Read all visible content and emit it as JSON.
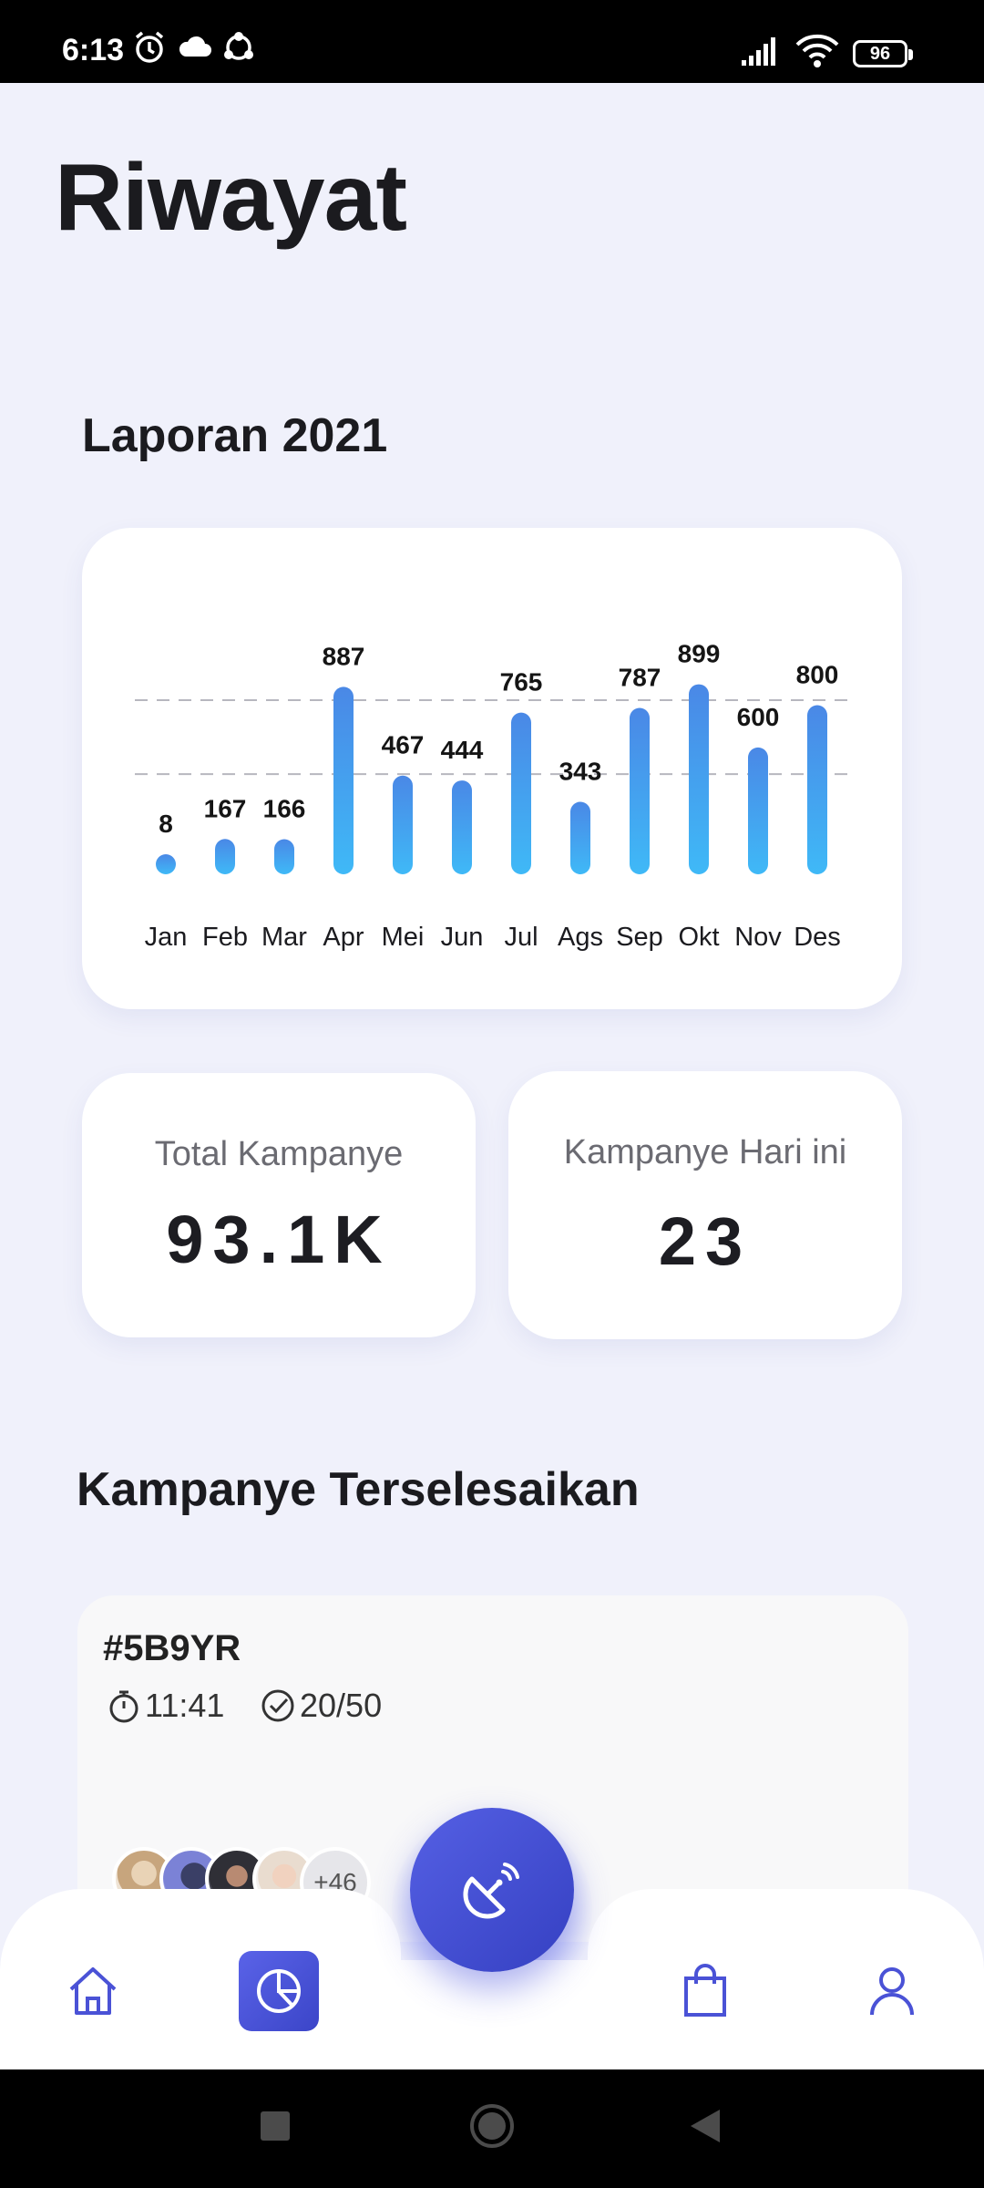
{
  "status_bar": {
    "time": "6:13",
    "battery": "96",
    "icons": [
      "alarm-icon",
      "cloud-icon",
      "sync-icon",
      "signal-icon",
      "wifi-icon",
      "battery-icon"
    ]
  },
  "page": {
    "title": "Riwayat"
  },
  "report": {
    "title": "Laporan 2021"
  },
  "chart_data": {
    "type": "bar",
    "categories": [
      "Jan",
      "Feb",
      "Mar",
      "Apr",
      "Mei",
      "Jun",
      "Jul",
      "Ags",
      "Sep",
      "Okt",
      "Nov",
      "Des"
    ],
    "values": [
      8,
      167,
      166,
      887,
      467,
      444,
      765,
      343,
      787,
      899,
      600,
      800
    ],
    "title": "",
    "xlabel": "",
    "ylabel": "",
    "ylim": [
      0,
      1000
    ],
    "grid": "dashed horizontal lines",
    "colors": {
      "bar_top": "#4a88e6",
      "bar_bottom": "#3fb9f7"
    }
  },
  "stats": {
    "total_label": "Total Kampanye",
    "total_value": "93.1K",
    "today_label": "Kampanye Hari ini",
    "today_value": "23"
  },
  "completed": {
    "title": "Kampanye Terselesaikan",
    "items": [
      {
        "id": "#5B9YR",
        "time": "11:41",
        "progress": "20/50",
        "more_count": "+46"
      }
    ]
  },
  "nav": {
    "items": [
      "home-icon",
      "history-pie-icon",
      "broadcast-icon",
      "shopping-bag-icon",
      "profile-icon"
    ],
    "active": "history-pie-icon"
  },
  "colors": {
    "accent": "#4a52d6",
    "background": "#f0f1fb"
  }
}
